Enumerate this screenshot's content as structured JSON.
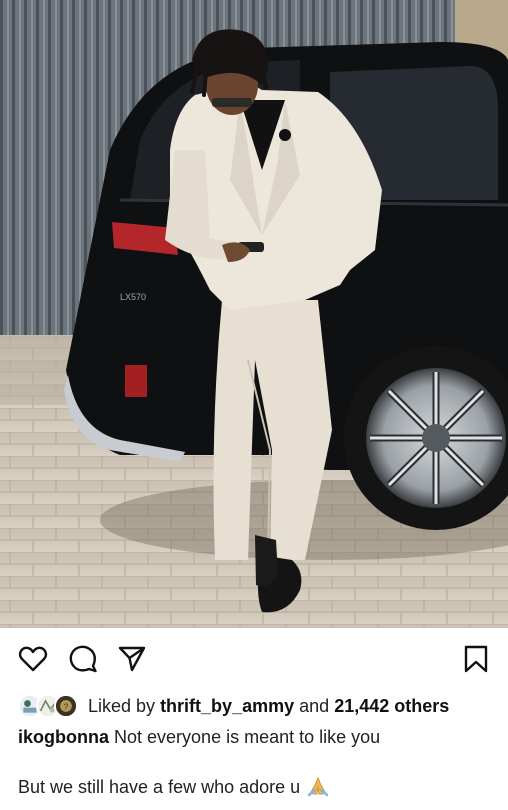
{
  "post": {
    "photo_description_icon": "post-photo",
    "actions": {
      "like_icon": "heart-outline",
      "comment_icon": "speech-bubble",
      "share_icon": "paper-plane",
      "save_icon": "bookmark"
    },
    "likes": {
      "prefix": "Liked by",
      "user": "thrift_by_ammy",
      "conjunction": "and",
      "others": "21,442 others"
    },
    "caption": {
      "username": "ikogbonna",
      "line1": "Not everyone is meant to like you",
      "line2": "But we still have a few who adore u",
      "emoji": "folded-hands"
    }
  }
}
